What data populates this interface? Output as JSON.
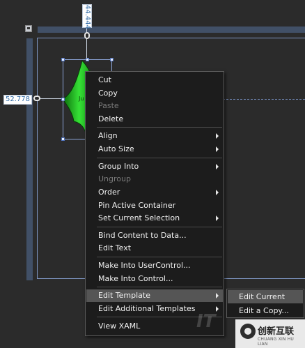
{
  "designer": {
    "height_measure": "44.444",
    "left_measure": "52.778",
    "shape_glyph": "Ju"
  },
  "context_menu": {
    "items": [
      {
        "label": "Cut",
        "enabled": true
      },
      {
        "label": "Copy",
        "enabled": true
      },
      {
        "label": "Paste",
        "enabled": false
      },
      {
        "label": "Delete",
        "enabled": true
      },
      {
        "label": "Align",
        "enabled": true,
        "submenu": true
      },
      {
        "label": "Auto Size",
        "enabled": true,
        "submenu": true
      },
      {
        "label": "Group Into",
        "enabled": true,
        "submenu": true
      },
      {
        "label": "Ungroup",
        "enabled": false
      },
      {
        "label": "Order",
        "enabled": true,
        "submenu": true
      },
      {
        "label": "Pin Active Container",
        "enabled": true
      },
      {
        "label": "Set Current Selection",
        "enabled": true,
        "submenu": true
      },
      {
        "label": "Bind Content to Data...",
        "enabled": true
      },
      {
        "label": "Edit Text",
        "enabled": true
      },
      {
        "label": "Make Into UserControl...",
        "enabled": true
      },
      {
        "label": "Make Into Control...",
        "enabled": true
      },
      {
        "label": "Edit Template",
        "enabled": true,
        "submenu": true,
        "highlighted": true
      },
      {
        "label": "Edit Additional Templates",
        "enabled": true,
        "submenu": true
      },
      {
        "label": "View XAML",
        "enabled": true
      }
    ]
  },
  "edit_template_submenu": {
    "items": [
      {
        "label": "Edit Current",
        "highlighted": true
      },
      {
        "label": "Edit a Copy..."
      }
    ]
  },
  "watermark": {
    "brand": "创新互联",
    "tagline": "CHUANG XIN HU LIAN",
    "it_mark": "IT"
  },
  "colors": {
    "canvas_bg": "#2b2b2b",
    "ruler": "#415067",
    "artboard_border": "#7f97c4",
    "menu_bg": "#1c1c1c",
    "menu_highlight": "#555555",
    "shape_fill": "#20c020"
  }
}
